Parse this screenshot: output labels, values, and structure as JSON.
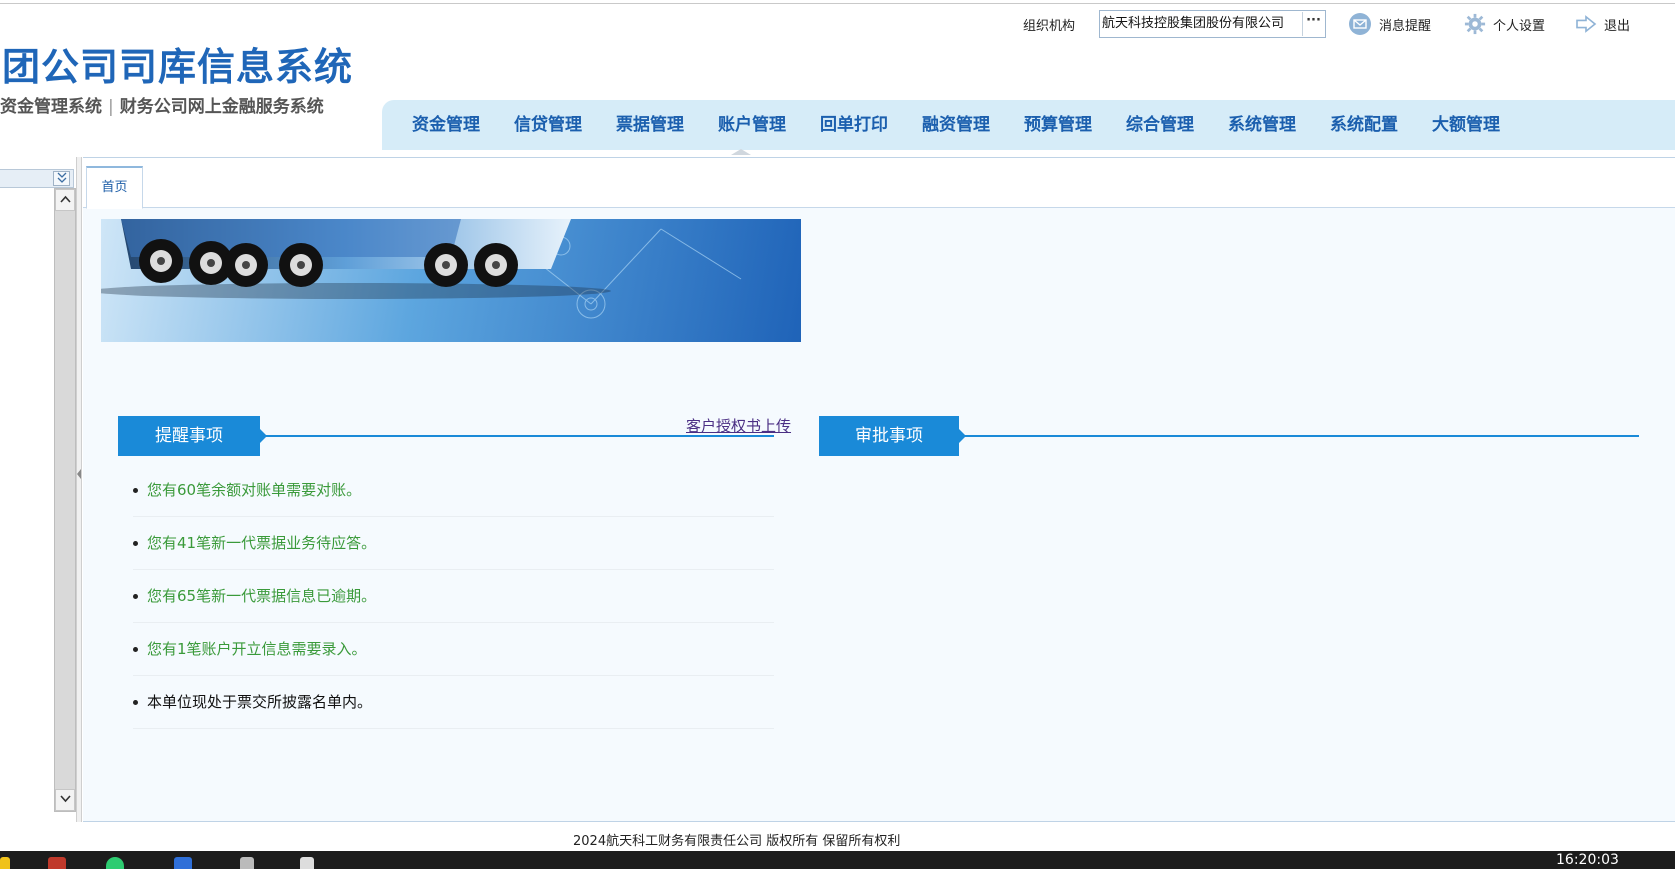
{
  "header": {
    "title": "团公司司库信息系统",
    "subtitle_left": "资金管理系统",
    "subtitle_sep": "|",
    "subtitle_right": "财务公司网上金融服务系统",
    "org_label": "组织机构",
    "org_value": "航天科技控股集团股份有限公司",
    "org_picker": "···",
    "messages": "消息提醒",
    "settings": "个人设置",
    "logout": "退出"
  },
  "menu": [
    "资金管理",
    "信贷管理",
    "票据管理",
    "账户管理",
    "回单打印",
    "融资管理",
    "预算管理",
    "综合管理",
    "系统管理",
    "系统配置",
    "大额管理"
  ],
  "tabs": {
    "home": "首页"
  },
  "reminders": {
    "title": "提醒事项",
    "upload_link": "客户授权书上传",
    "items": [
      {
        "text": "您有60笔余额对账单需要对账。"
      },
      {
        "text": "您有41笔新一代票据业务待应答。"
      },
      {
        "text": "您有65笔新一代票据信息已逾期。"
      },
      {
        "text": "您有1笔账户开立信息需要录入。"
      },
      {
        "text": "本单位现处于票交所披露名单内。"
      }
    ]
  },
  "approvals": {
    "title": "审批事项"
  },
  "footer": {
    "copyright": "2024航天科工财务有限责任公司 版权所有 保留所有权利"
  },
  "taskbar": {
    "clock": "16:20:03"
  },
  "colors": {
    "brand_blue": "#1a8ad8",
    "menu_text": "#1b5fae",
    "menu_bg": "#d6ecf8",
    "reminder_green": "#3a9a3a",
    "link_purple": "#4b2f84"
  }
}
